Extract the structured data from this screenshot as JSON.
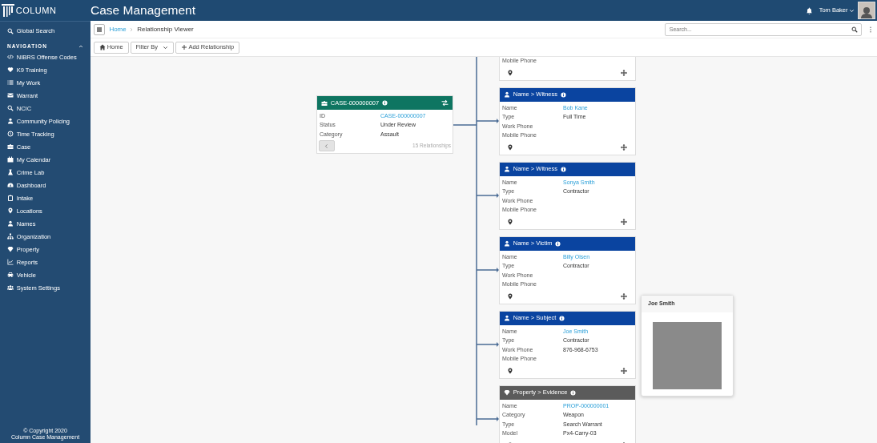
{
  "header": {
    "logo": "COLUMN",
    "app_title": "Case Management",
    "user": "Tom Baker"
  },
  "sidebar": {
    "search": "Global Search",
    "section": "NAVIGATION",
    "section_expanded": true,
    "items": [
      {
        "label": "NIBRS Offense Codes"
      },
      {
        "label": "K9 Training"
      },
      {
        "label": "My Work"
      },
      {
        "label": "Warrant"
      },
      {
        "label": "NCIC"
      },
      {
        "label": "Community Policing"
      },
      {
        "label": "Time Tracking"
      },
      {
        "label": "Case"
      },
      {
        "label": "My Calendar"
      },
      {
        "label": "Crime Lab"
      },
      {
        "label": "Dashboard"
      },
      {
        "label": "Intake"
      },
      {
        "label": "Locations"
      },
      {
        "label": "Names"
      },
      {
        "label": "Organization"
      },
      {
        "label": "Property"
      },
      {
        "label": "Reports"
      },
      {
        "label": "Vehicle"
      },
      {
        "label": "System Settings"
      }
    ],
    "footer": [
      "© Copyright 2020",
      "Column Case Management"
    ]
  },
  "breadcrumb": [
    {
      "label": "Home",
      "current": false
    },
    {
      "label": "Relationship Viewer",
      "current": true
    }
  ],
  "search": {
    "placeholder": "Search..."
  },
  "toolbar": [
    {
      "label": "Home",
      "kind": "home"
    },
    {
      "label": "Filter By",
      "kind": "dropdown"
    },
    {
      "label": "Add Relationship",
      "kind": "add"
    }
  ],
  "case_node": {
    "title": "CASE-000000007",
    "fields": [
      {
        "label": "ID",
        "value": "CASE-000000007",
        "link": true
      },
      {
        "label": "Status",
        "value": "Under Review",
        "link": false
      },
      {
        "label": "Category",
        "value": "Assault",
        "link": false
      }
    ],
    "relationships": "15 Relationships"
  },
  "related_nodes": [
    {
      "kind": "partial",
      "fields": [
        {
          "label": "Mobile Phone"
        }
      ]
    },
    {
      "kind": "name",
      "title": "Name > Witness",
      "fields": [
        {
          "label": "Name",
          "value": "Bob Kane",
          "link": true
        },
        {
          "label": "Type",
          "value": "Full Time",
          "link": false
        },
        {
          "label": "Work Phone"
        },
        {
          "label": "Mobile Phone"
        }
      ]
    },
    {
      "kind": "name",
      "title": "Name > Witness",
      "fields": [
        {
          "label": "Name",
          "value": "Sonya Smith",
          "link": true
        },
        {
          "label": "Type",
          "value": "Contractor",
          "link": false
        },
        {
          "label": "Work Phone"
        },
        {
          "label": "Mobile Phone"
        }
      ]
    },
    {
      "kind": "name",
      "title": "Name > Victim",
      "fields": [
        {
          "label": "Name",
          "value": "Billy Olsen",
          "link": true
        },
        {
          "label": "Type",
          "value": "Contractor",
          "link": false
        },
        {
          "label": "Work Phone"
        },
        {
          "label": "Mobile Phone"
        }
      ]
    },
    {
      "kind": "name",
      "title": "Name > Subject",
      "fields": [
        {
          "label": "Name",
          "value": "Joe Smith",
          "link": true
        },
        {
          "label": "Type",
          "value": "Contractor",
          "link": false
        },
        {
          "label": "Work Phone",
          "value": "876-968-6753",
          "link": false
        },
        {
          "label": "Mobile Phone"
        }
      ]
    },
    {
      "kind": "property",
      "title": "Property > Evidence",
      "fields": [
        {
          "label": "Name",
          "value": "PROP-000000001",
          "link": true
        },
        {
          "label": "Category",
          "value": "Weapon",
          "link": false
        },
        {
          "label": "Type",
          "value": "Search Warrant",
          "link": false
        },
        {
          "label": "Model",
          "value": "Px4-Carry-03",
          "link": false
        }
      ]
    }
  ],
  "popover": {
    "title": "Joe Smith"
  }
}
